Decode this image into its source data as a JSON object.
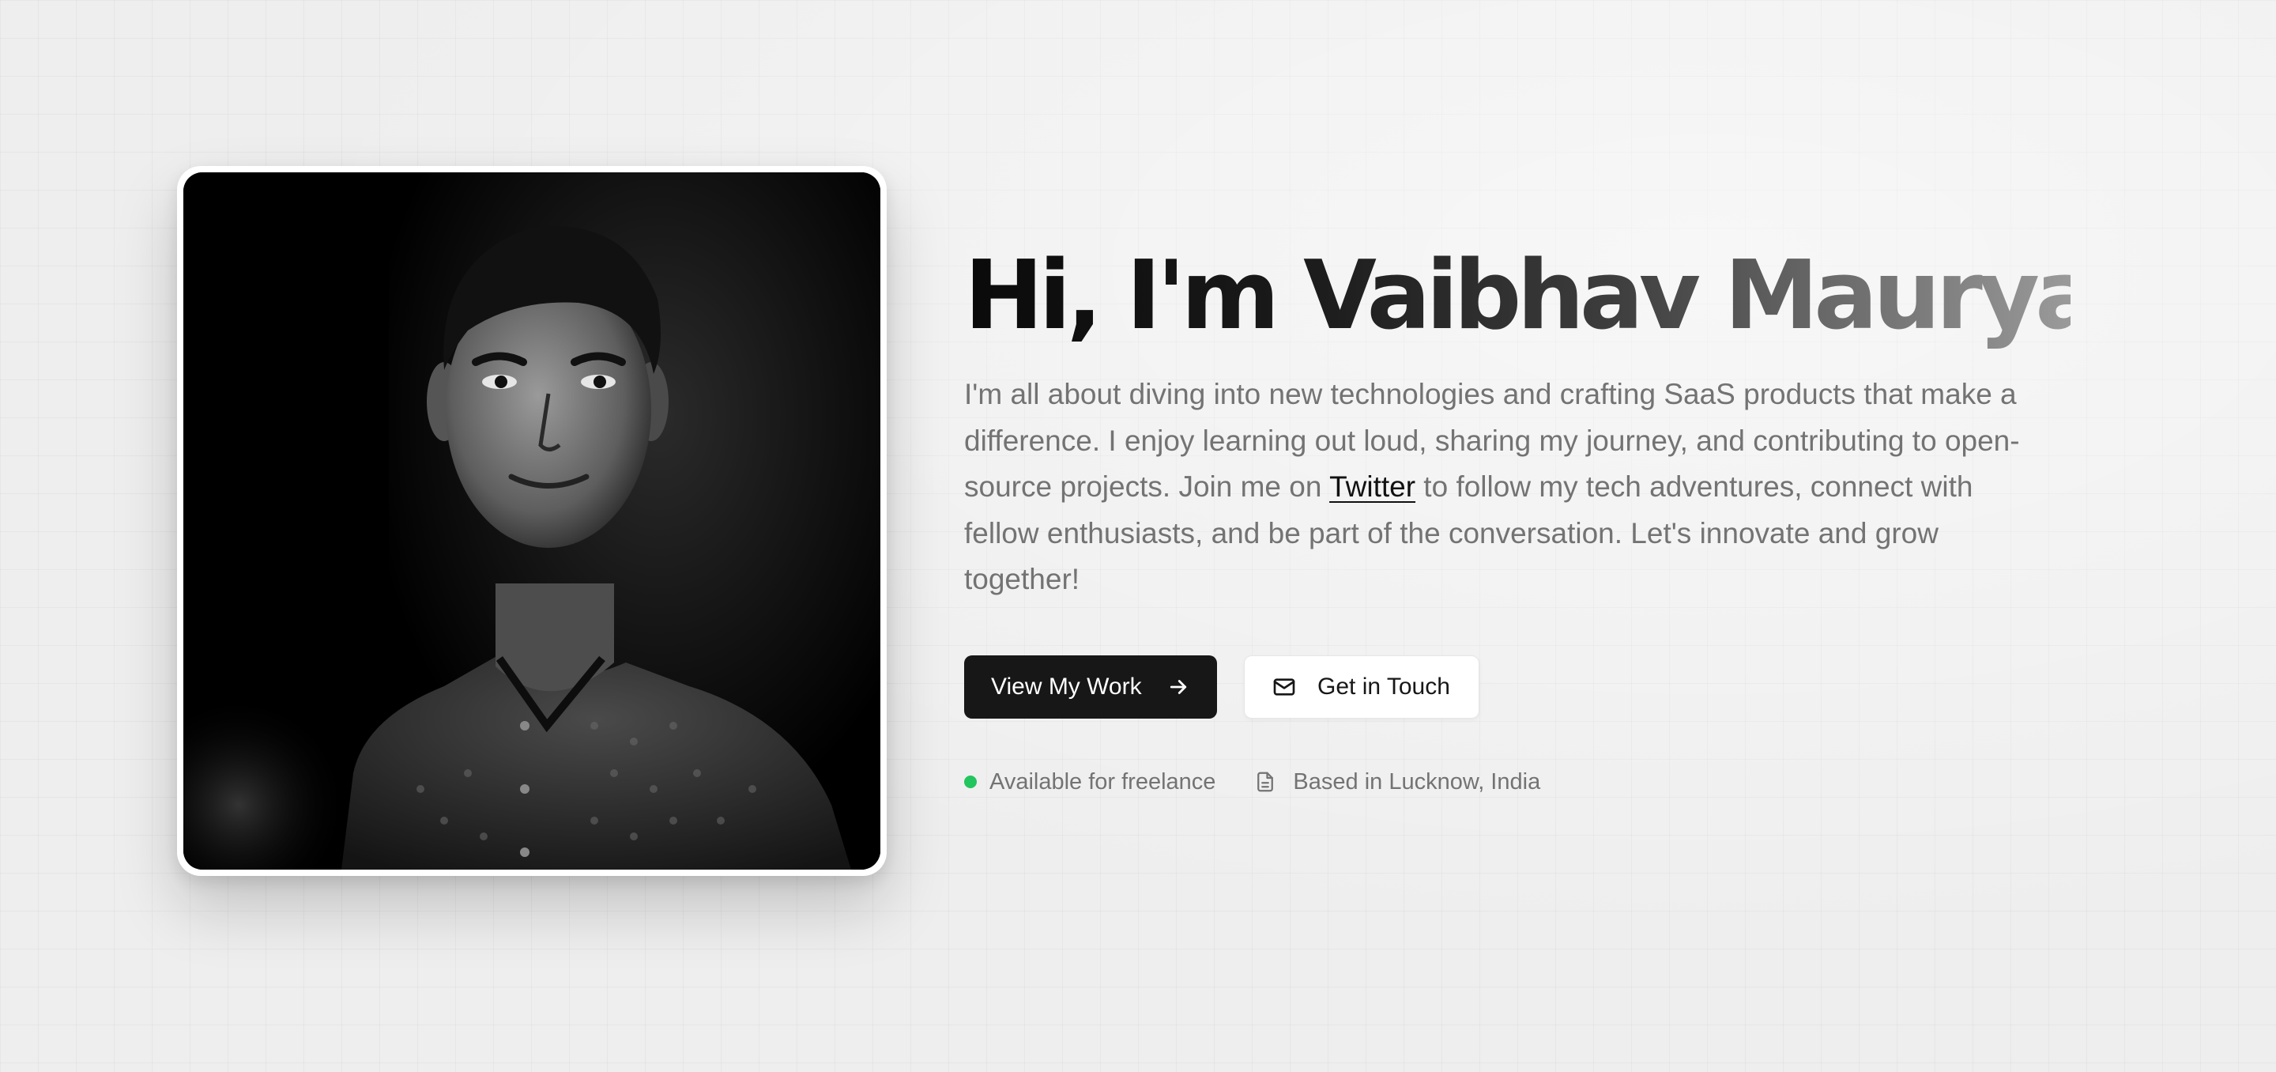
{
  "hero": {
    "name": "Hi, I'm Vaibhav Maurya",
    "bio_before": "I'm all about diving into new technologies and crafting SaaS products that make a difference. I enjoy learning out loud, sharing my journey, and contributing to open-source projects. Join me on ",
    "bio_link": "Twitter",
    "bio_after": " to follow my tech adventures, connect with fellow enthusiasts, and be part of the conversation. Let's innovate and grow together!",
    "photo": "portrait-photo"
  },
  "actions": {
    "primary_label": "View My Work",
    "primary_icon": "arrow-right-icon",
    "secondary_label": "Get in Touch",
    "secondary_icon": "mail-icon"
  },
  "meta": {
    "availability": "Available for freelance",
    "availability_color": "#22c55e",
    "location": "Based in Lucknow, India",
    "location_icon": "file-text-icon"
  }
}
